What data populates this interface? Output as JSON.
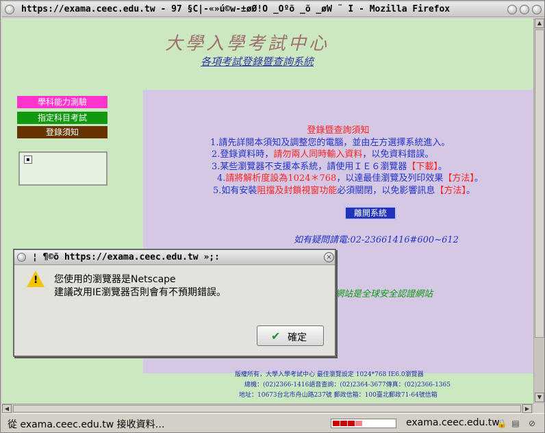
{
  "window": {
    "title": "https://exama.ceec.edu.tw - 97 §C|-«»ú©w-±øØ!Ó _Öºõ _õ _øW ¨ Î - Mozilla Firefox"
  },
  "page": {
    "logo": "大學入學考試中心",
    "subtitle": "各項考試登錄暨查詢系統",
    "menu": [
      {
        "label": "學科能力測驗"
      },
      {
        "label": "指定科目考試"
      },
      {
        "label": "登錄須知"
      }
    ],
    "notice_title": "登錄暨查詢須知",
    "notices": {
      "l1": "1.請先詳閱本須知及調整您的電腦，並由左方選擇系統進入。",
      "l2a": "2.登錄資料時，",
      "l2b": "請勿兩人同時輸入資料",
      "l2c": "，以免資料錯誤。",
      "l3a": "3.某些瀏覽器不支援本系統，請使用ＩＥ６瀏覽器",
      "l3b": "【下載】",
      "l3c": "。",
      "l4a": "4.",
      "l4b": "請將解析度設為1024＊768",
      "l4c": "，以達最佳瀏覽及列印效果",
      "l4d": "【方法】",
      "l4e": "。",
      "l5a": "5.如有安裝",
      "l5b": "阻擋及封鎖視窗功能",
      "l5c": "必須關閉，以免影響訊息",
      "l5d": "【方法】",
      "l5e": "。"
    },
    "leave_button": "離開系統",
    "contact": "如有疑問請電:02-23661416#600~612",
    "secure_text": "網站是全球安全認證網站",
    "footer": {
      "line1": "版權所有，大學入學考試中心  最佳瀏覽設定  1024*768  IE6.0瀏覽器",
      "line2": "總機：(02)2366-1416語音查詢：(02)2364-3677傳真：(02)2366-1365",
      "line3": "地址：10673台北市舟山路237號  郵政信箱：100臺北郵政71-64號信箱"
    }
  },
  "dialog": {
    "title": "¦ ¶©õ https://exama.ceec.edu.tw »;:",
    "message_line1": "您使用的瀏覽器是Netscape",
    "message_line2": "建議改用IE瀏覽器否則會有不預期錯誤。",
    "ok_label": "確定"
  },
  "status": {
    "text": "從 exama.ceec.edu.tw 接收資料…",
    "domain": "exama.ceec.edu.tw",
    "progress": 0.3
  }
}
